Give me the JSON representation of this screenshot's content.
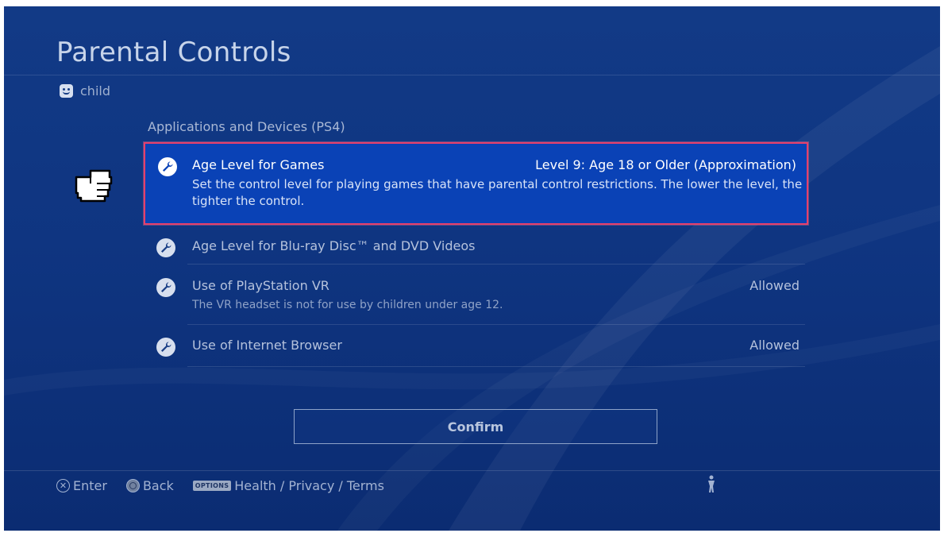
{
  "header": {
    "title": "Parental Controls"
  },
  "user": {
    "name": "child",
    "icon": "smile-face-icon"
  },
  "section": {
    "title": "Applications and Devices (PS4)"
  },
  "items": [
    {
      "label": "Age Level for Games",
      "value": "Level 9: Age 18 or Older (Approximation)",
      "description": "Set the control level for playing games that have parental control restrictions. The lower the level, the tighter the control.",
      "selected": true,
      "icon": "wrench-icon"
    },
    {
      "label": "Age Level for Blu-ray Disc™ and DVD Videos",
      "value": "",
      "description": "",
      "selected": false,
      "icon": "wrench-icon"
    },
    {
      "label": "Use of PlayStation VR",
      "value": "Allowed",
      "description": "The VR headset is not for use by children under age 12.",
      "selected": false,
      "icon": "wrench-icon"
    },
    {
      "label": "Use of Internet Browser",
      "value": "Allowed",
      "description": "",
      "selected": false,
      "icon": "wrench-icon"
    }
  ],
  "confirm": {
    "label": "Confirm"
  },
  "footer": {
    "enter_label": "Enter",
    "back_label": "Back",
    "options_badge": "OPTIONS",
    "options_label": "Health / Privacy / Terms"
  },
  "colors": {
    "background": "#0f3581",
    "selected_row": "#0a42b6",
    "highlight_border": "#e6406c"
  }
}
